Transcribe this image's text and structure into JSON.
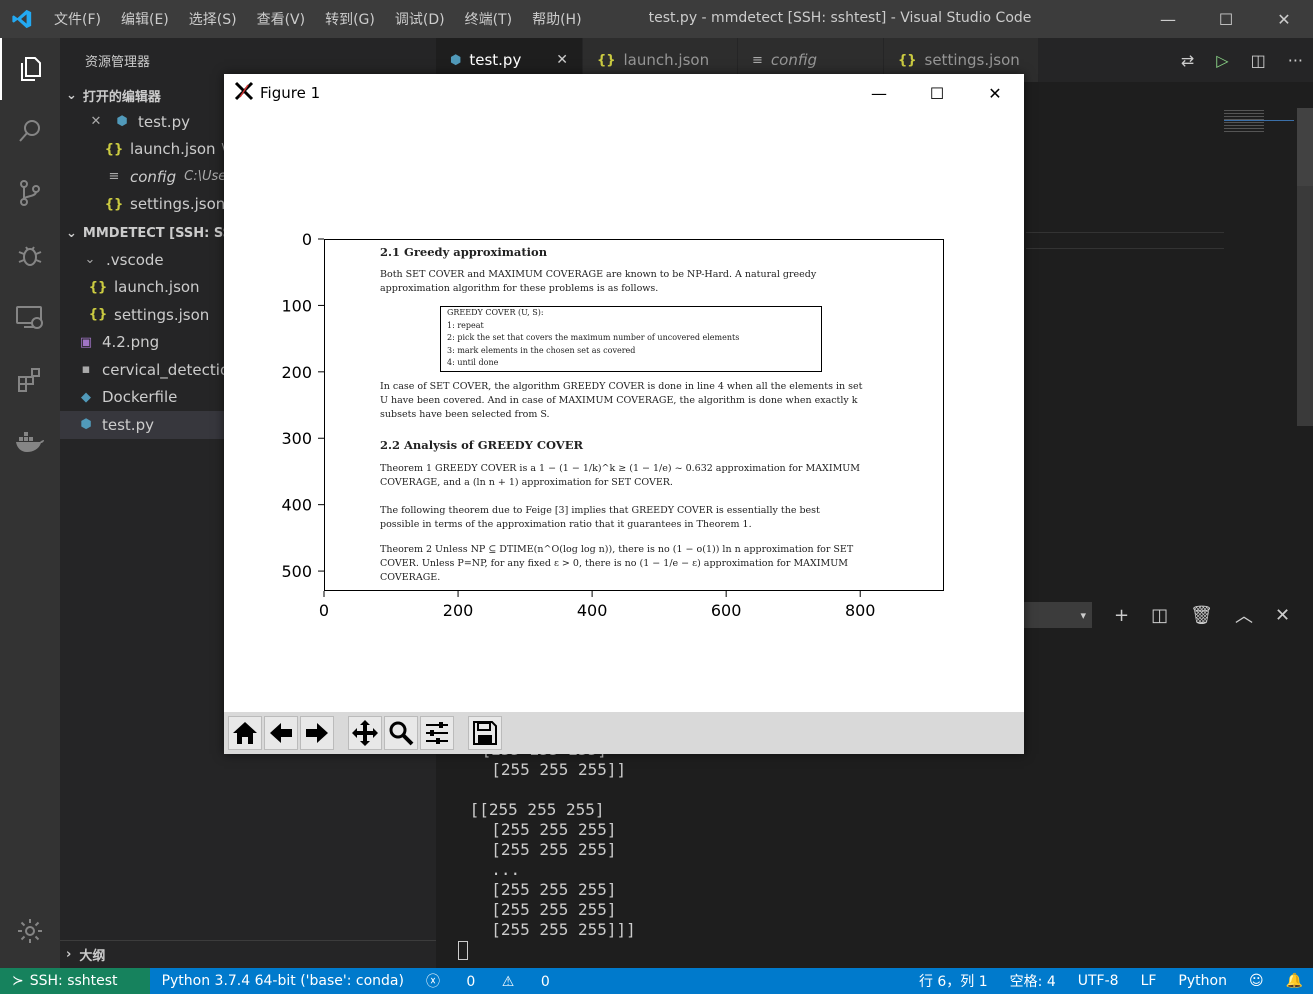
{
  "window": {
    "title": "test.py - mmdetect [SSH: sshtest] - Visual Studio Code",
    "menu": [
      "文件(F)",
      "编辑(E)",
      "选择(S)",
      "查看(V)",
      "转到(G)",
      "调试(D)",
      "终端(T)",
      "帮助(H)"
    ]
  },
  "sidebar": {
    "title": "资源管理器",
    "open_editors_header": "打开的编辑器",
    "open_editors": [
      {
        "name": "test.py",
        "icon": "python-icon"
      },
      {
        "name": "launch.json",
        "path": "\\",
        "icon": "json-icon"
      },
      {
        "name": "config",
        "path": "C:\\User",
        "icon": "config-icon"
      },
      {
        "name": "settings.json",
        "icon": "json-icon"
      }
    ],
    "workspace_header": "MMDETECT [SSH: SSH",
    "tree": [
      {
        "name": ".vscode",
        "type": "folder"
      },
      {
        "name": "launch.json",
        "type": "json"
      },
      {
        "name": "settings.json",
        "type": "json"
      },
      {
        "name": "4.2.png",
        "type": "image"
      },
      {
        "name": "cervical_detection",
        "type": "file"
      },
      {
        "name": "Dockerfile",
        "type": "docker"
      },
      {
        "name": "test.py",
        "type": "python"
      }
    ],
    "outline_header": "大纲"
  },
  "tabs": [
    {
      "label": "test.py",
      "icon": "python-icon"
    },
    {
      "label": "launch.json",
      "icon": "json-icon"
    },
    {
      "label": "config",
      "icon": "config-icon"
    },
    {
      "label": "settings.json",
      "icon": "json-icon"
    }
  ],
  "figure": {
    "title": "Figure 1",
    "doc": {
      "h1": "2.1   Greedy approximation",
      "p1a": "Both SET COVER  and MAXIMUM COVERAGE  are known to be NP-Hard.  A natural greedy",
      "p1b": "approximation algorithm for these problems is as follows.",
      "algo": [
        "GREEDY COVER (U, S):",
        "1: repeat",
        "2:         pick the set that covers the maximum number of uncovered elements",
        "3:         mark elements in the chosen set as covered",
        "4: until done"
      ],
      "p2a": "In case of SET COVER, the algorithm GREEDY COVER is done in line 4 when all the elements in set",
      "p2b": "U have been covered. And in case of MAXIMUM COVERAGE, the algorithm is done when exactly k",
      "p2c": "subsets have been selected from S.",
      "h2": "2.2   Analysis of GREEDY COVER",
      "t1a": "Theorem 1  GREEDY COVER is a 1 − (1 − 1/k)^k ≥ (1 − 1/e) ~ 0.632 approximation for MAXIMUM",
      "t1b": "COVERAGE, and a (ln n + 1) approximation for SET COVER.",
      "p3a": "   The following theorem due to Feige [3] implies that GREEDY COVER is essentially the best",
      "p3b": "possible in terms of the approximation ratio that it guarantees in Theorem 1.",
      "t2a": "Theorem 2  Unless NP ⊆ DTIME(n^O(log log n)), there is no (1 − o(1)) ln n approximation for SET",
      "t2b": "COVER. Unless P=NP, for any fixed ε > 0, there is no (1 − 1/e − ε) approximation for MAXIMUM",
      "t2c": "COVERAGE."
    },
    "chart_data": {
      "type": "image",
      "xticks": [
        "0",
        "200",
        "400",
        "600",
        "800"
      ],
      "yticks": [
        "0",
        "100",
        "200",
        "300",
        "400",
        "500"
      ],
      "xlim": [
        0,
        925
      ],
      "ylim": [
        530,
        0
      ]
    }
  },
  "panel": {
    "terminal_lines": [
      " [255 255 255]",
      "  [255 255 255]]",
      "",
      " [[255 255 255]",
      "  [255 255 255]",
      "  [255 255 255]",
      "  ...",
      "  [255 255 255]",
      "  [255 255 255]",
      "  [255 255 255]]]"
    ]
  },
  "status": {
    "remote": "SSH: sshtest",
    "python": "Python 3.7.4 64-bit ('base': conda)",
    "errors": "0",
    "warnings": "0",
    "position": "行 6，列 1",
    "spaces": "空格: 4",
    "encoding": "UTF-8",
    "eol": "LF",
    "language": "Python"
  }
}
